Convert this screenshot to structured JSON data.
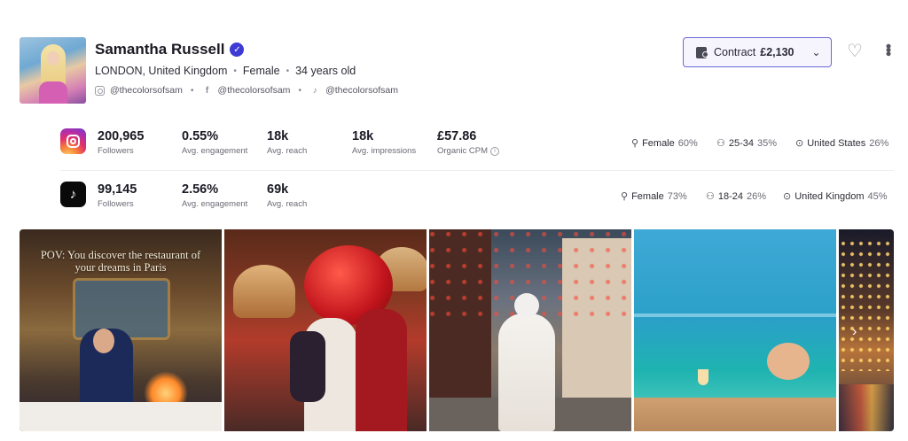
{
  "profile": {
    "name": "Samantha Russell",
    "location": "LONDON, United Kingdom",
    "gender": "Female",
    "age": "34 years old",
    "socials": {
      "instagram": "@thecolorsofsam",
      "facebook": "@thecolorsofsam",
      "tiktok": "@thecolorsofsam"
    }
  },
  "contract": {
    "label": "Contract",
    "amount": "£2,130"
  },
  "instagram": {
    "stats": [
      {
        "value": "200,965",
        "label": "Followers"
      },
      {
        "value": "0.55%",
        "label": "Avg. engagement"
      },
      {
        "value": "18k",
        "label": "Avg. reach"
      },
      {
        "value": "18k",
        "label": "Avg. impressions"
      },
      {
        "value": "£57.86",
        "label": "Organic CPM"
      }
    ],
    "demographics": {
      "gender": "Female",
      "gender_pct": "60%",
      "age": "25-34",
      "age_pct": "35%",
      "country": "United States",
      "country_pct": "26%"
    }
  },
  "tiktok": {
    "stats": [
      {
        "value": "99,145",
        "label": "Followers"
      },
      {
        "value": "2.56%",
        "label": "Avg. engagement"
      },
      {
        "value": "69k",
        "label": "Avg. reach"
      }
    ],
    "demographics": {
      "gender": "Female",
      "gender_pct": "73%",
      "age": "18-24",
      "age_pct": "26%",
      "country": "United Kingdom",
      "country_pct": "45%"
    }
  },
  "posts": {
    "caption_1": "POV: You discover the restaurant of your dreams in Paris"
  },
  "icons": {
    "verified": "verified-badge-icon",
    "heart": "heart-icon",
    "more": "more-vertical-icon",
    "next": "chevron-right-icon"
  },
  "colors": {
    "accent": "#6b68d6",
    "verified": "#3d3bd4"
  }
}
